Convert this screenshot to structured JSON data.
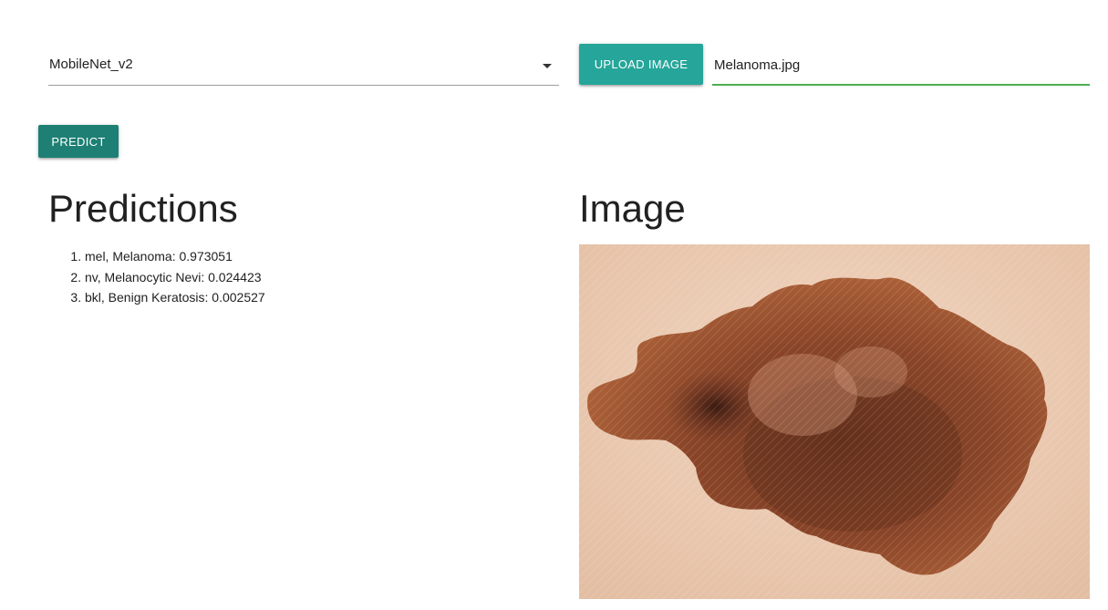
{
  "model_select": {
    "value": "MobileNet_v2",
    "icon": "arrow-drop-down-icon"
  },
  "upload": {
    "button_label": "UPLOAD IMAGE",
    "file_name": "Melanoma.jpg"
  },
  "predict": {
    "button_label": "PREDICT"
  },
  "predictions": {
    "title": "Predictions",
    "items": [
      "mel, Melanoma: 0.973051",
      "nv, Melanocytic Nevi: 0.024423",
      "bkl, Benign Keratosis: 0.002527"
    ]
  },
  "image_panel": {
    "title": "Image"
  },
  "colors": {
    "upload_button": "#26a69a",
    "predict_button": "#1e7f74",
    "file_field_underline": "#4caf50"
  }
}
